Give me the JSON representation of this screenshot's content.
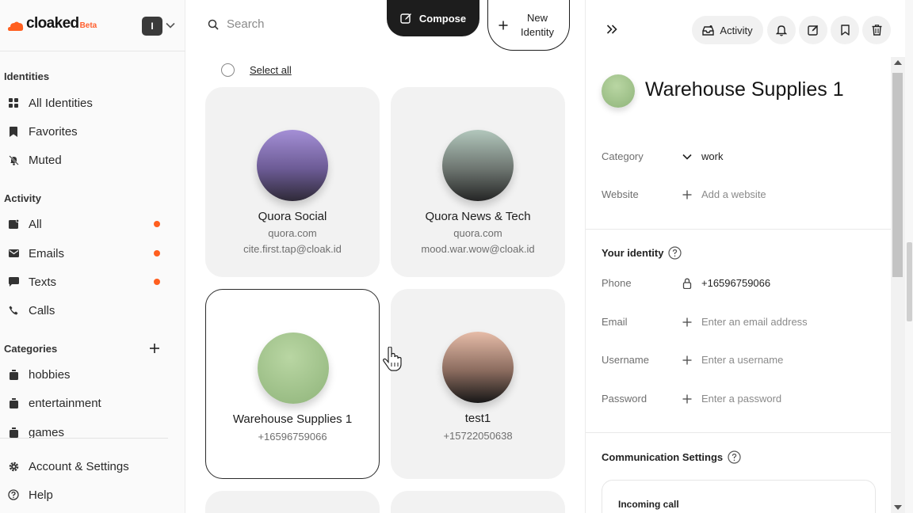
{
  "app": {
    "brand": "cloaked",
    "badge": "Beta",
    "user_initial": "I"
  },
  "sidebar": {
    "identities_label": "Identities",
    "identities": [
      {
        "label": "All Identities",
        "icon": "grid-icon"
      },
      {
        "label": "Favorites",
        "icon": "bookmark-icon"
      },
      {
        "label": "Muted",
        "icon": "bell-off-icon"
      }
    ],
    "activity_label": "Activity",
    "activity": [
      {
        "label": "All",
        "icon": "inbox-icon",
        "unread": true
      },
      {
        "label": "Emails",
        "icon": "mail-icon",
        "unread": true
      },
      {
        "label": "Texts",
        "icon": "chat-icon",
        "unread": true
      },
      {
        "label": "Calls",
        "icon": "phone-icon",
        "unread": false
      }
    ],
    "categories_label": "Categories",
    "categories": [
      {
        "label": "hobbies",
        "icon": "folder-icon"
      },
      {
        "label": "entertainment",
        "icon": "folder-icon"
      },
      {
        "label": "games",
        "icon": "folder-icon"
      }
    ],
    "footer": [
      {
        "label": "Account & Settings",
        "icon": "gear-icon"
      },
      {
        "label": "Help",
        "icon": "help-icon"
      }
    ],
    "accent_color": "#ff5f1f"
  },
  "toolbar": {
    "search_placeholder": "Search",
    "compose_label": "Compose",
    "new_identity_label": "New Identity",
    "select_all_label": "Select all"
  },
  "identities": [
    {
      "name": "Quora Social",
      "website": "quora.com",
      "email": "cite.first.tap@cloak.id",
      "colors": [
        "#a48fd6",
        "#2f2a38"
      ]
    },
    {
      "name": "Quora News & Tech",
      "website": "quora.com",
      "email": "mood.war.wow@cloak.id",
      "colors": [
        "#b2c7bc",
        "#252525"
      ]
    },
    {
      "name": "Warehouse Supplies 1",
      "phone": "+16596759066",
      "colors": [
        "#b9d6a3",
        "#8fb47a"
      ],
      "selected": true
    },
    {
      "name": "test1",
      "phone": "+15722050638",
      "colors": [
        "#e6bca8",
        "#171717"
      ]
    }
  ],
  "detail": {
    "activity_label": "Activity",
    "title": "Warehouse Supplies 1",
    "category_label": "Category",
    "category_value": "work",
    "website_label": "Website",
    "website_placeholder": "Add a website",
    "your_identity_label": "Your identity",
    "phone_label": "Phone",
    "phone_value": "+16596759066",
    "email_label": "Email",
    "email_placeholder": "Enter an email address",
    "username_label": "Username",
    "username_placeholder": "Enter a username",
    "password_label": "Password",
    "password_placeholder": "Enter a password",
    "communication_label": "Communication Settings",
    "incoming_call_label": "Incoming call"
  }
}
